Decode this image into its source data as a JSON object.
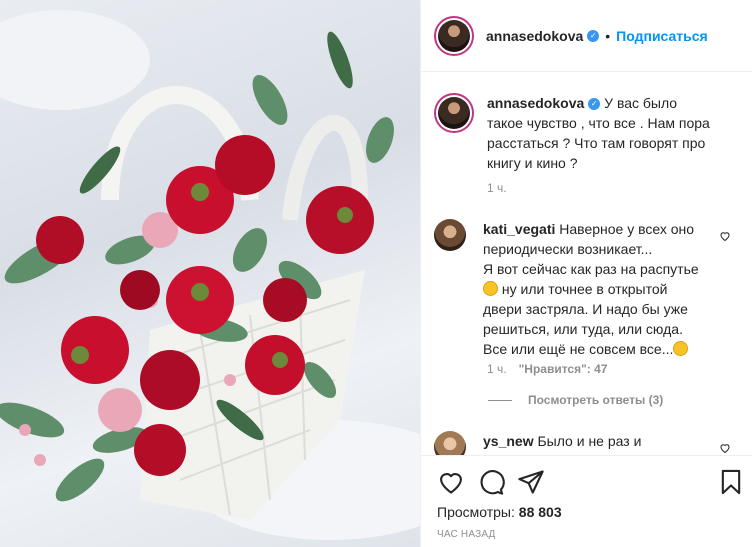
{
  "post": {
    "author": "annasedokova",
    "follow_label": "Подписаться",
    "separator": "•",
    "caption": "У вас было такое чувство , что все . Нам пора расстаться ? Что там говорят про книгу и кино ?",
    "caption_time": "1 ч."
  },
  "comments": [
    {
      "author": "kati_vegati",
      "text_lines": [
        "Наверное у всех оно",
        "периодически возникает...",
        "Я вот сейчас как раз на распутье",
        "ну или точнее в открытой",
        "двери застряла. И надо бы уже",
        "решиться, или туда, или сюда.",
        "Все или ещё не совсем все..."
      ],
      "time": "1 ч.",
      "likes": "\"Нравится\": 47",
      "replies": "Посмотреть ответы (3)"
    },
    {
      "author": "ys_new",
      "text": "Было и не раз и"
    }
  ],
  "footer": {
    "views_label": "Просмотры:",
    "views_count": "88 803",
    "timestamp": "ЧАС НАЗАД"
  },
  "colors": {
    "accent": "#0095f6",
    "verified": "#3897f0",
    "muted": "#8e8e8e",
    "flower_red": "#c8102e"
  },
  "icons": [
    "verified-badge-icon",
    "heart-icon",
    "comment-icon",
    "share-icon",
    "bookmark-icon",
    "smile-emoji"
  ]
}
